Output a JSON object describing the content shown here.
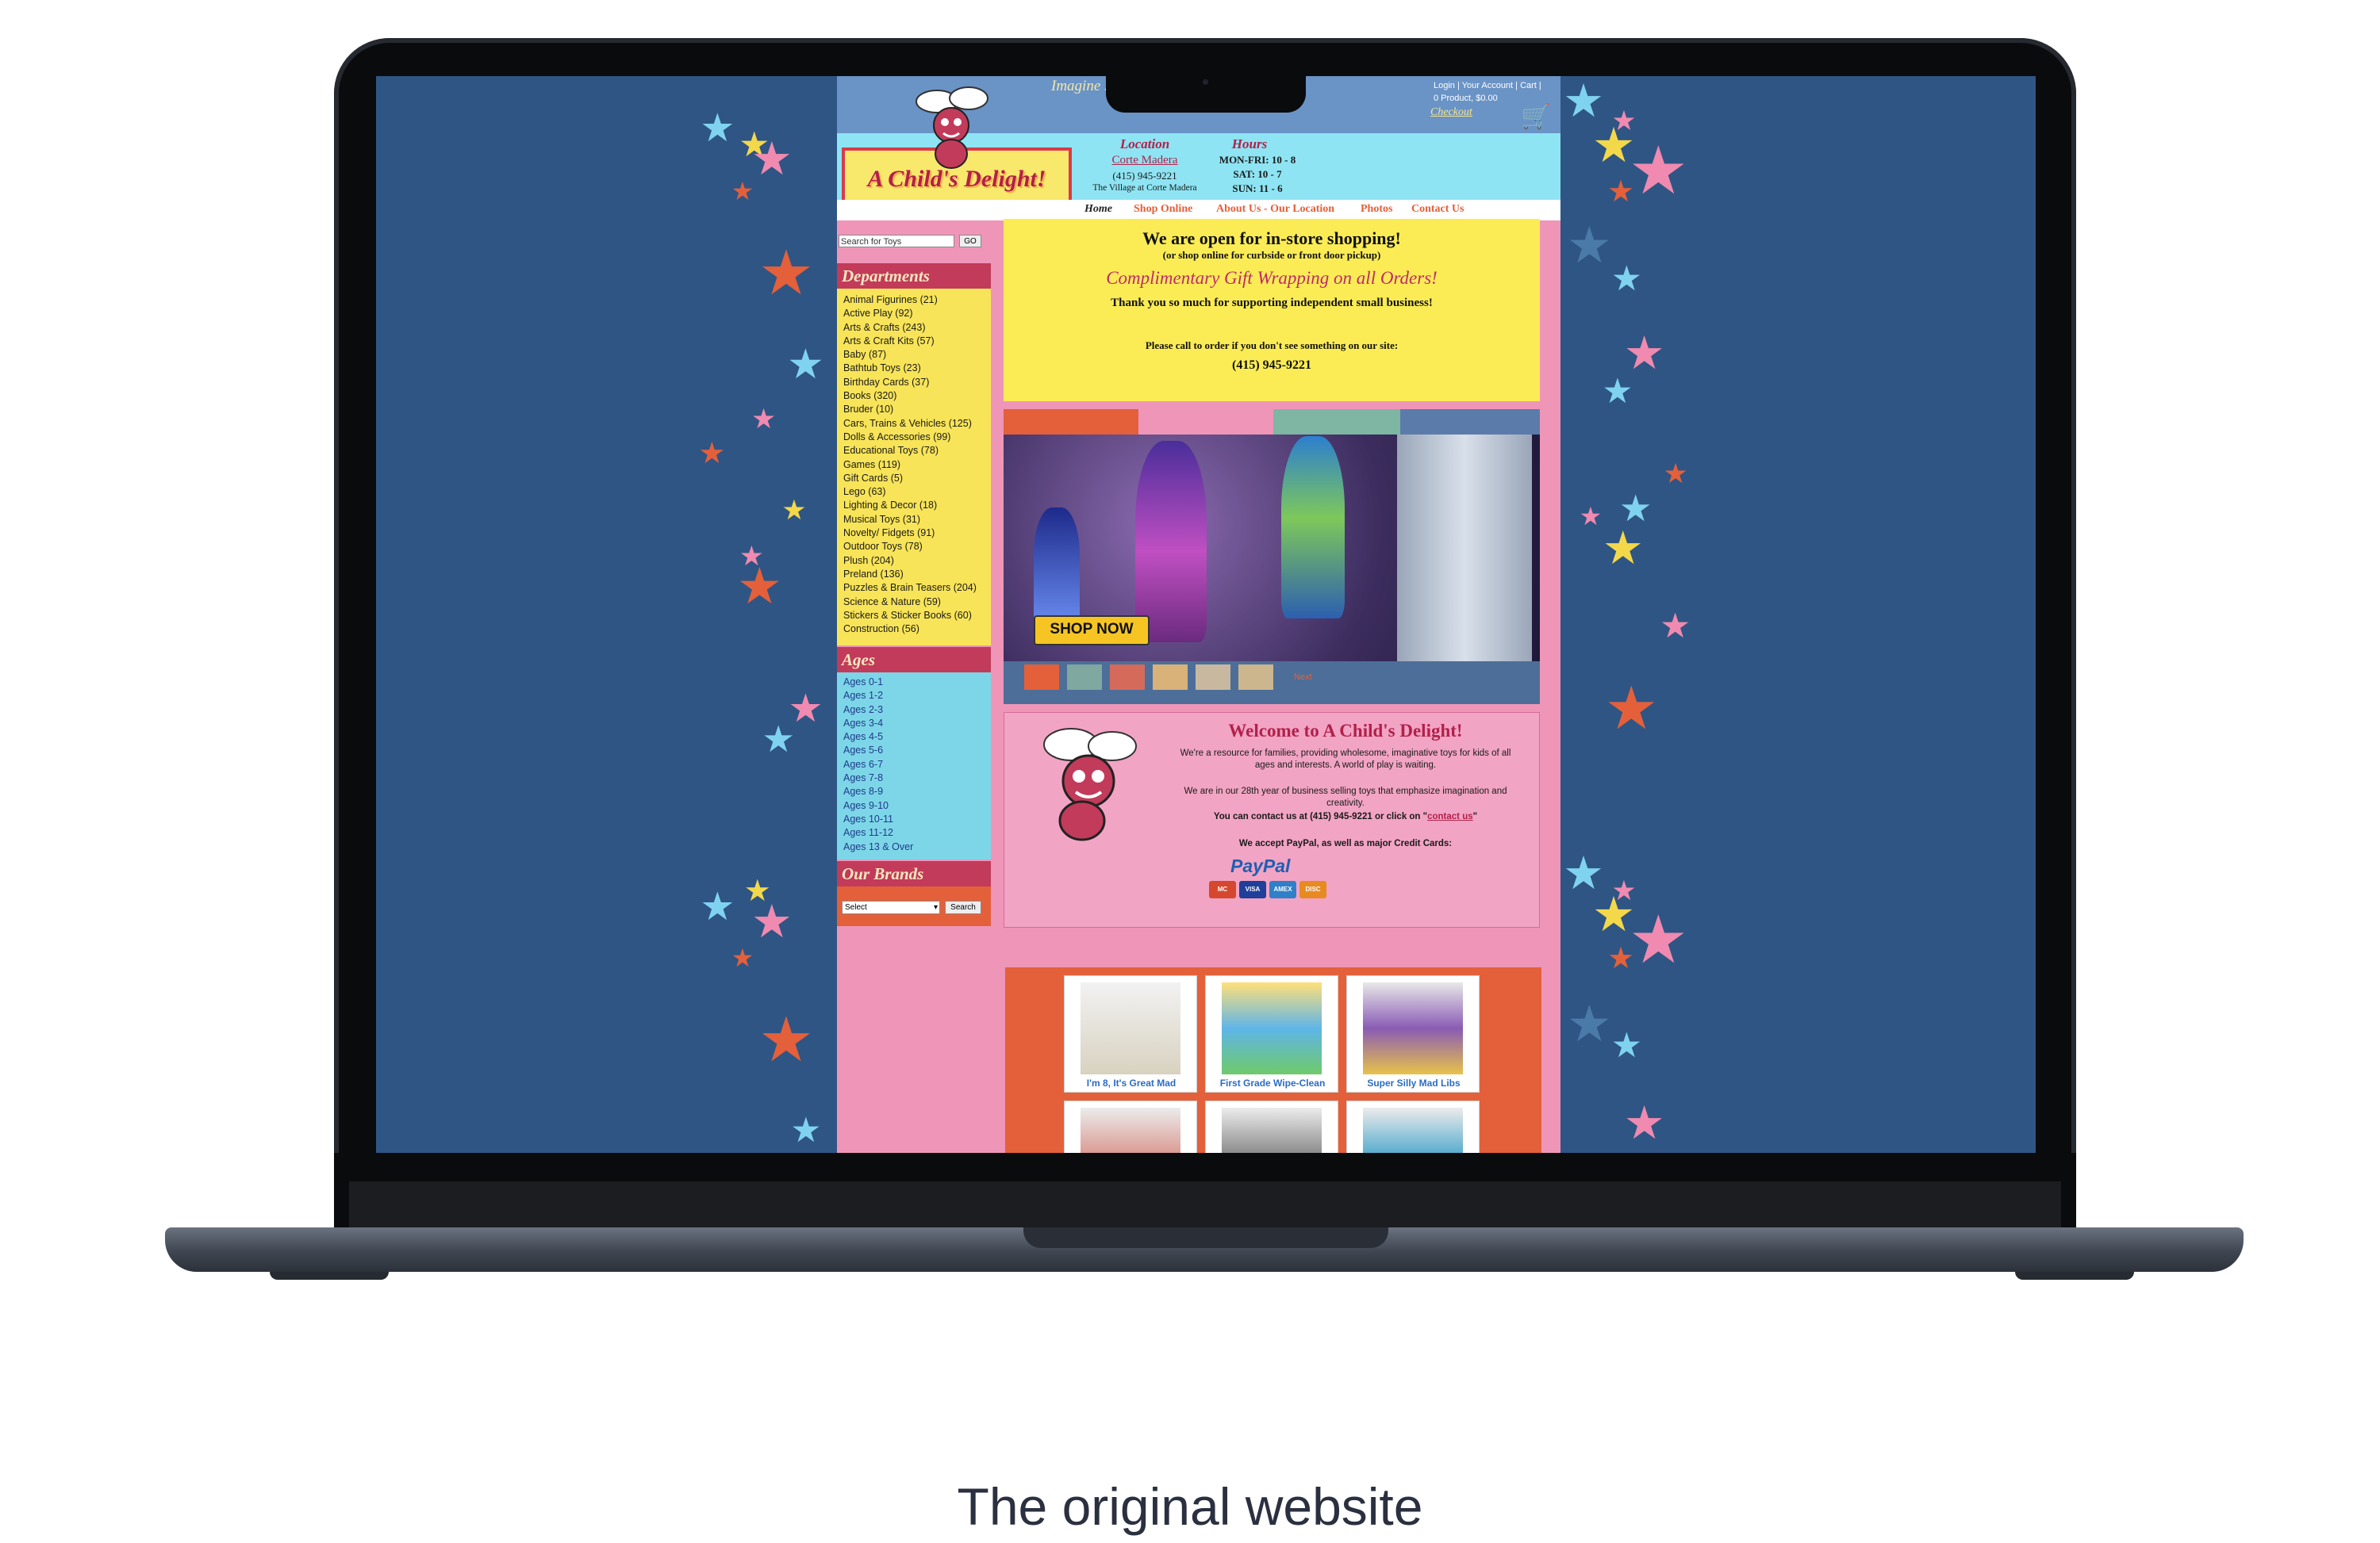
{
  "caption": "The original website",
  "site": {
    "tagline": "Imagine ... d Childhood",
    "account_links": "Login | Your Account | Cart |",
    "cart_summary": "0 Product, $0.00",
    "checkout": "Checkout",
    "logo_text": "A Child's Delight!",
    "location": {
      "heading": "Location",
      "city": "Corte Madera",
      "phone": "(415) 945-9221",
      "address": "The Village at Corte Madera"
    },
    "hours": {
      "heading": "Hours",
      "rows": [
        "MON-FRI: 10 - 8",
        "SAT: 10 - 7",
        "SUN: 11 - 6"
      ]
    },
    "nav": [
      "Home",
      "Shop Online",
      "About Us - Our Location",
      "Photos",
      "Contact Us"
    ],
    "search": {
      "placeholder": "Search for Toys",
      "button": "GO"
    },
    "departments": {
      "heading": "Departments",
      "items": [
        "Animal Figurines (21)",
        "Active Play (92)",
        "Arts & Crafts (243)",
        "Arts & Craft Kits (57)",
        "Baby (87)",
        "Bathtub Toys (23)",
        "Birthday Cards (37)",
        "Books (320)",
        "Bruder (10)",
        "Cars, Trains & Vehicles (125)",
        "Dolls & Accessories (99)",
        "Educational Toys (78)",
        "Games (119)",
        "Gift Cards (5)",
        "Lego (63)",
        "Lighting & Decor (18)",
        "Musical Toys (31)",
        "Novelty/ Fidgets (91)",
        "Outdoor Toys (78)",
        "Plush (204)",
        "Preland (136)",
        "Puzzles & Brain Teasers (204)",
        "Science & Nature (59)",
        "Stickers & Sticker Books (60)",
        "Construction (56)"
      ]
    },
    "ages": {
      "heading": "Ages",
      "items": [
        "Ages 0-1",
        "Ages 1-2",
        "Ages 2-3",
        "Ages 3-4",
        "Ages 4-5",
        "Ages 5-6",
        "Ages 6-7",
        "Ages 7-8",
        "Ages 8-9",
        "Ages 9-10",
        "Ages 10-11",
        "Ages 11-12",
        "Ages 13 & Over"
      ]
    },
    "brands": {
      "heading": "Our Brands",
      "select": "Select",
      "button": "Search"
    },
    "open_notice": {
      "headline": "We are open for in-store shopping!",
      "sub": "(or shop online for curbside or front door pickup)",
      "gift": "Complimentary Gift Wrapping on all Orders!",
      "thanks": "Thank you so much for supporting independent small business!",
      "call": "Please call to order if you don't see something on our site:",
      "phone": "(415) 945-9221"
    },
    "banner": {
      "button": "SHOP NOW",
      "next": "Next"
    },
    "welcome": {
      "title": "Welcome to A Child's Delight!",
      "p1": "We're a resource for families, providing wholesome, imaginative toys for kids of all ages and interests. A world of play is waiting.",
      "p2": "We are in our 28th year of business selling toys that emphasize imagination and creativity.",
      "contact_prefix": "You can contact us at (415) 945-9221 or click on \"",
      "contact_link": "contact us",
      "contact_suffix": "\"",
      "payment": "We accept PayPal, as well as major Credit Cards:",
      "paypal": "PayPal",
      "cards": [
        "MC",
        "VISA",
        "AMEX",
        "DISC"
      ]
    },
    "products": [
      {
        "title": "I'm 8, It's Great Mad"
      },
      {
        "title": "First Grade Wipe-Clean"
      },
      {
        "title": "Super Silly Mad Libs"
      }
    ]
  },
  "colors": {
    "background": "#2f5584",
    "site_pink": "#ef96b8",
    "accent_red": "#b2204a",
    "nav_orange": "#e4603a",
    "notice_yellow": "#fbec56"
  }
}
